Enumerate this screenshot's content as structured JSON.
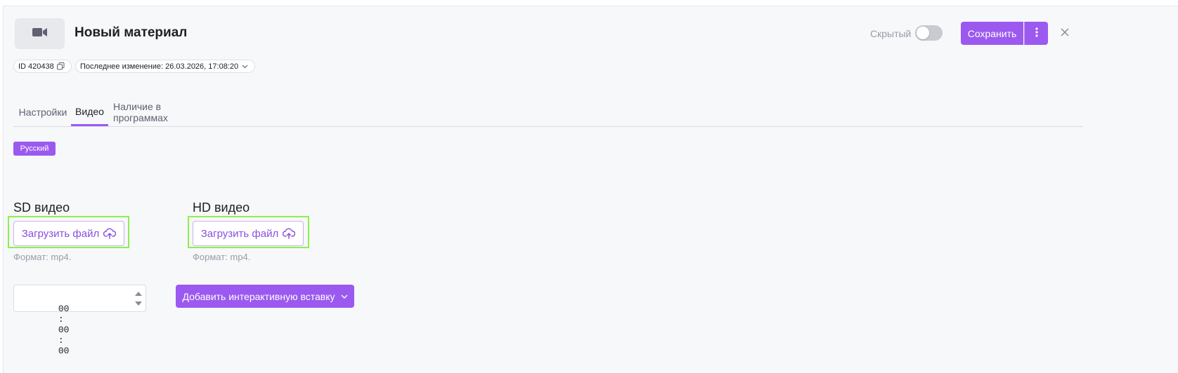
{
  "header": {
    "title": "Новый материал",
    "thumb_icon": "video-camera-icon",
    "visibility_label": "Скрытый",
    "visibility_on": false,
    "save_label": "Сохранить",
    "more_icon": "kebab-menu-icon",
    "close_icon": "close-icon"
  },
  "meta": {
    "id_label": "ID 420438",
    "copy_icon": "copy-icon",
    "last_modified": "Последнее изменение: 26.03.2026, 17:08:20",
    "dropdown_icon": "chevron-down-icon"
  },
  "tabs": [
    {
      "label": "Настройки",
      "active": false
    },
    {
      "label": "Видео",
      "active": true
    },
    {
      "label": "Наличие в программах",
      "active": false
    }
  ],
  "language_badge": "Русский",
  "video": {
    "sd": {
      "title": "SD видео",
      "upload_label": "Загрузить файл",
      "format": "Формат: mp4."
    },
    "hd": {
      "title": "HD видео",
      "upload_label": "Загрузить файл",
      "format": "Формат: mp4."
    },
    "upload_icon": "cloud-upload-icon"
  },
  "timecode": {
    "hours": "00",
    "minutes": "00",
    "seconds": "00",
    "separator": ":"
  },
  "add_insert": {
    "label": "Добавить интерактивную вставку",
    "icon": "chevron-down-icon"
  },
  "colors": {
    "accent": "#9b59f0",
    "highlight": "#8cf04d",
    "background": "#f7f8fa"
  }
}
